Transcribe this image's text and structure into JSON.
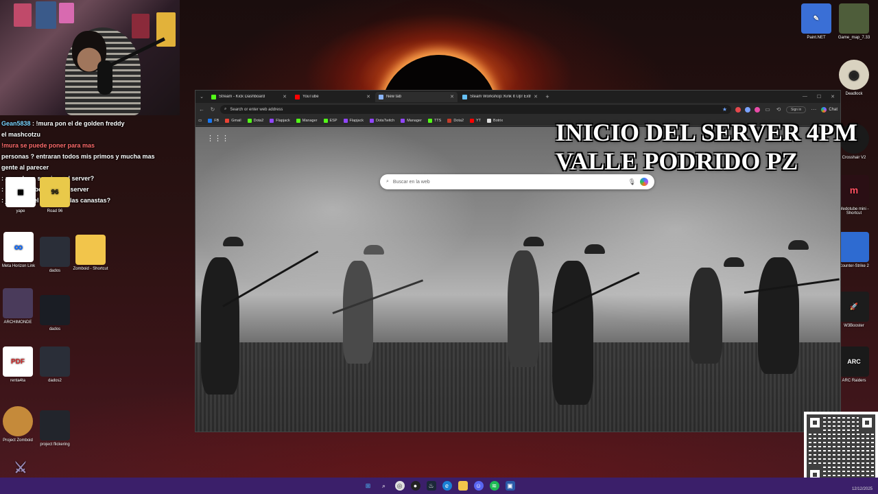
{
  "overlay": {
    "line1": "INICIO DEL SERVER 4PM",
    "line2": "VALLE PODRIDO PZ"
  },
  "chat": [
    {
      "user": "Gean5838",
      "text": ": !mura pon el de golden freddy",
      "color": "#7cd4ff"
    },
    {
      "user": "",
      "text": "el mashcotzu",
      "color": "#ffffff"
    },
    {
      "user": "",
      "text": "!mura se puede poner para mas",
      "color": "#ff4d4d"
    },
    {
      "user": "",
      "text": "personas ? entraran todos mis primos y mucha mas",
      "color": "#ffffff"
    },
    {
      "user": "",
      "text": "gente al parecer",
      "color": "#ffffff"
    },
    {
      "user": "",
      "text": ": a esa hora se wipea el server?",
      "color": "#7cff7c"
    },
    {
      "user": "",
      "text": ": !mura desbeanme del server",
      "color": "#ffffff"
    },
    {
      "user": "",
      "text": ": jaculito y el sorteo de las canastas?",
      "color": "#ffd24d"
    }
  ],
  "desktop_left": [
    {
      "name": "yape",
      "color": "#ffffff"
    },
    {
      "name": "Road 96",
      "color": "#e9c94a"
    },
    {
      "name": "Meta Horizon Link",
      "color": "#ffffff"
    },
    {
      "name": "dados",
      "color": "#2a2e38"
    },
    {
      "name": "Zomboid - Shortcut",
      "color": "#f2c54b"
    },
    {
      "name": "ARCHIMONDE",
      "color": "#4a3b5b"
    },
    {
      "name": "dados",
      "color": "#1a1d24"
    },
    {
      "name": "renta4ta",
      "color": "#ffffff"
    },
    {
      "name": "dados2",
      "color": "#2a2e38"
    },
    {
      "name": "Project Zomboid",
      "color": "#c58a3a"
    },
    {
      "name": "project flickering",
      "color": "#22252c"
    }
  ],
  "desktop_right": [
    {
      "name": "Paint.NET",
      "color": "#3a6fd6"
    },
    {
      "name": "Game_map_7.33",
      "color": "#4e5d3a"
    },
    {
      "name": "Deadlock",
      "color": "#d9d2c0"
    },
    {
      "name": "Crosshair V2",
      "color": "#1a1a1a"
    },
    {
      "name": "Medotube mini - Shortcut",
      "color": "#2a0f14"
    },
    {
      "name": "Counter-Strike 2",
      "color": "#2e6bd1"
    },
    {
      "name": "W3Booster",
      "color": "#1c1c1c"
    },
    {
      "name": "ARC Raiders",
      "color": "#1a1a1a"
    }
  ],
  "browser": {
    "tabs": [
      {
        "label": "Stream - Kick Dashboard",
        "icon_color": "#53fc18",
        "active": false
      },
      {
        "label": "YouTube",
        "icon_color": "#ff0000",
        "active": false
      },
      {
        "label": "New tab",
        "icon_color": "#8ab4f8",
        "active": true
      },
      {
        "label": "Steam Workshop::Kink It Up! Extra",
        "icon_color": "#66c0f4",
        "active": false
      }
    ],
    "address_placeholder": "Search or enter web address",
    "signin": "Sign in",
    "chat_label": "Chat",
    "bookmarks": [
      {
        "label": "FB",
        "color": "#1877f2"
      },
      {
        "label": "Gmail",
        "color": "#ea4335"
      },
      {
        "label": "Dota2",
        "color": "#53fc18"
      },
      {
        "label": "Flapjack",
        "color": "#9146ff"
      },
      {
        "label": "Manager",
        "color": "#53fc18"
      },
      {
        "label": "ESP",
        "color": "#53fc18"
      },
      {
        "label": "Flapjack",
        "color": "#9146ff"
      },
      {
        "label": "DotaTwitch",
        "color": "#9146ff"
      },
      {
        "label": "Manager",
        "color": "#9146ff"
      },
      {
        "label": "TTS",
        "color": "#53fc18"
      },
      {
        "label": "Dota2",
        "color": "#c23c2a"
      },
      {
        "label": "YT",
        "color": "#ff0000"
      },
      {
        "label": "Botrix",
        "color": "#dddddd"
      }
    ],
    "search_placeholder": "Buscar en la web"
  },
  "taskbar": {
    "apps": [
      "start",
      "search",
      "chrome",
      "obs",
      "steam",
      "edge",
      "files",
      "discord",
      "spotify",
      "explorer"
    ],
    "tray_time": "12/12/2025"
  }
}
